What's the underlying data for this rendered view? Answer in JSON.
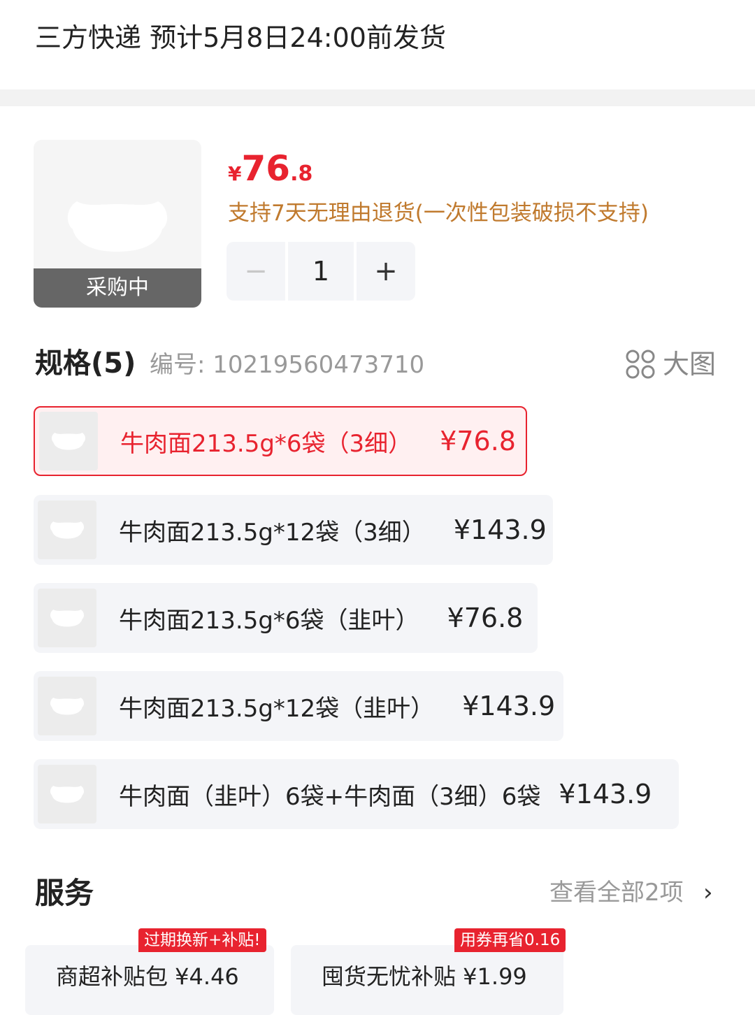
{
  "shipping": {
    "text": "三方快递 预计5月8日24:00前发货"
  },
  "product": {
    "thumb_status": "采购中",
    "price_currency": "¥",
    "price_int": "76",
    "price_dec": ".8",
    "return_note": "支持7天无理由退货(一次性包装破损不支持)",
    "quantity": "1",
    "minus_glyph": "−",
    "plus_glyph": "+"
  },
  "spec": {
    "title": "规格(5)",
    "code": "编号: 10219560473710",
    "big_view_label": "大图",
    "options": [
      {
        "name": "牛肉面213.5g*6袋（3细）",
        "price": "¥76.8",
        "selected": true
      },
      {
        "name": "牛肉面213.5g*12袋（3细）",
        "price": "¥143.9",
        "selected": false
      },
      {
        "name": "牛肉面213.5g*6袋（韭叶）",
        "price": "¥76.8",
        "selected": false
      },
      {
        "name": "牛肉面213.5g*12袋（韭叶）",
        "price": "¥143.9",
        "selected": false
      },
      {
        "name": "牛肉面（韭叶）6袋+牛肉面（3细）6袋",
        "price": "¥143.9",
        "selected": false
      }
    ]
  },
  "services": {
    "title": "服务",
    "view_all": "查看全部2项",
    "arrow": "›",
    "items": [
      {
        "tag": "过期换新+补贴!",
        "label": "商超补贴包  ¥4.46"
      },
      {
        "tag": "用券再省0.16",
        "label": "囤货无忧补贴  ¥1.99"
      }
    ]
  },
  "colors": {
    "accent": "#e8232f",
    "return_note": "#c07a2e",
    "muted": "#999999"
  }
}
